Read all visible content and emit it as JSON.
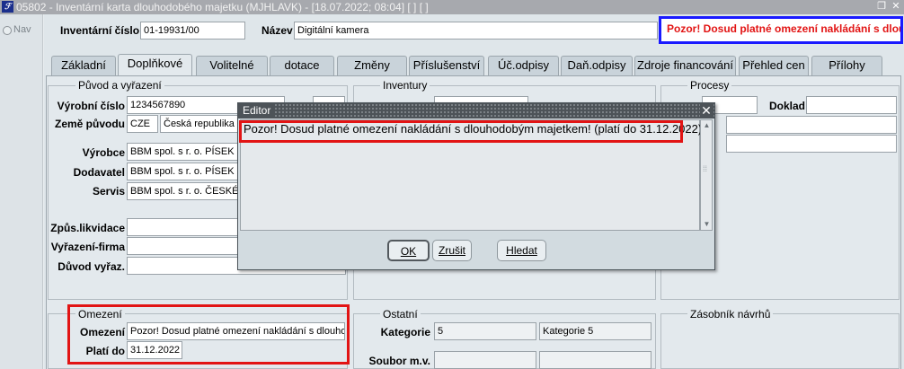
{
  "window": {
    "title": "05802 - Inventární karta dlouhodobého majetku (MJHLAVK) - [18.07.2022; 08:04]  [ ]  [ ]",
    "app_icon": "app-logo-icon",
    "controls": [
      "restore-icon",
      "close-icon"
    ]
  },
  "nav": {
    "label": "Nav"
  },
  "header": {
    "inventory_label": "Inventární číslo",
    "inventory_value": "01-19931/00",
    "name_label": "Název",
    "name_value": "Digitální kamera",
    "warning": "Pozor! Dosud platné omezení nakládání s dlouh"
  },
  "tabs": [
    {
      "label": "Základní"
    },
    {
      "label": "Doplňkové",
      "active": true
    },
    {
      "label": "Volitelné"
    },
    {
      "label": "dotace"
    },
    {
      "label": "Změny"
    },
    {
      "label": "Příslušenství"
    },
    {
      "label": "Úč.odpisy"
    },
    {
      "label": "Daň.odpisy"
    },
    {
      "label": "Zdroje financování"
    },
    {
      "label": "Přehled cen"
    },
    {
      "label": "Přílohy"
    }
  ],
  "origin": {
    "title": "Původ a vyřazení",
    "serial_label": "Výrobní číslo",
    "serial_value": "1234567890",
    "country_label": "Země původu",
    "country_code": "CZE",
    "country_name": "Česká republika",
    "manufacturer_label": "Výrobce",
    "manufacturer_value": "BBM spol. s r. o.  PÍSEK",
    "supplier_label": "Dodavatel",
    "supplier_value": "BBM spol. s r. o.  PÍSEK",
    "service_label": "Servis",
    "service_value": "BBM spol. s r. o.  ČESKÉ",
    "liquidation_label": "Způs.likvidace",
    "disposal_firm_label": "Vyřazení-firma",
    "disposal_reason_label": "Důvod vyřaz."
  },
  "inventory_group": {
    "title": "Inventury"
  },
  "processes": {
    "title": "Procesy",
    "document_label": "Doklad"
  },
  "restriction": {
    "title": "Omezení",
    "restriction_label": "Omezení",
    "restriction_value": "Pozor! Dosud platné omezení nakládání s dlouhod",
    "valid_label": "Platí do",
    "valid_value": "31.12.2022"
  },
  "other": {
    "title": "Ostatní",
    "category_label": "Kategorie",
    "category_code": "5",
    "category_name": "Kategorie 5",
    "file_label": "Soubor m.v."
  },
  "proposals": {
    "title": "Zásobník návrhů"
  },
  "editor": {
    "title": "Editor",
    "text": "Pozor! Dosud platné omezení nakládání s dlouhodobým majetkem! (platí do 31.12.2022)",
    "ok_label": "OK",
    "cancel_label": "Zrušit",
    "search_label": "Hledat"
  },
  "colors": {
    "highlight_red": "#e21414",
    "highlight_blue": "#1a1aff",
    "warning_text": "#e21414"
  }
}
